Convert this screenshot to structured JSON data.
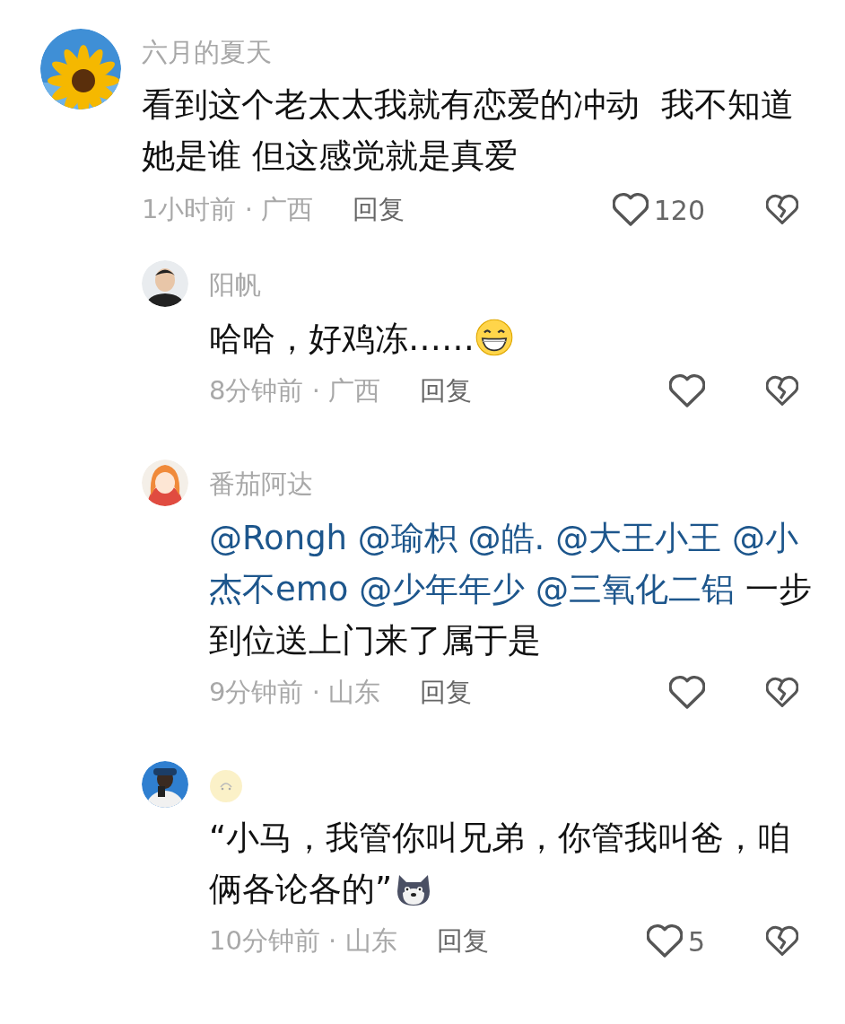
{
  "comments": [
    {
      "name": {
        "kind": "text",
        "text": "六月的夏天"
      },
      "body": [
        {
          "kind": "text",
          "text": "看到这个老太太我就有恋爱的冲动  我不知道她是谁 但这感觉就是真爱"
        }
      ],
      "time": "1小时前 · 广西",
      "reply_label": "回复",
      "likes": "120",
      "replies": [
        {
          "name": {
            "kind": "text",
            "text": "阳帆"
          },
          "body": [
            {
              "kind": "text",
              "text": "哈哈，好鸡冻……"
            },
            {
              "kind": "grin"
            }
          ],
          "time": "8分钟前 · 广西",
          "reply_label": "回复"
        },
        {
          "name": {
            "kind": "text",
            "text": "番茄阿达"
          },
          "body": [
            {
              "kind": "mention",
              "text": "@Rongh"
            },
            {
              "kind": "mention",
              "text": "@瑜枳"
            },
            {
              "kind": "mention",
              "text": "@皓."
            },
            {
              "kind": "mention",
              "text": "@大王小王"
            },
            {
              "kind": "mention",
              "text": "@小杰不emo"
            },
            {
              "kind": "mention",
              "text": "@少年年少"
            },
            {
              "kind": "mention",
              "text": "@三氧化二铝"
            },
            {
              "kind": "text",
              "text": "一步到位送上门来了属于是"
            }
          ],
          "time": "9分钟前 · 山东",
          "reply_label": "回复"
        },
        {
          "name": {
            "kind": "emoji"
          },
          "body": [
            {
              "kind": "text",
              "text": "“小马，我管你叫兄弟，你管我叫爸，咱俩各论各的”"
            },
            {
              "kind": "dog"
            }
          ],
          "time": "10分钟前 · 山东",
          "reply_label": "回复",
          "likes": "5"
        }
      ]
    }
  ]
}
